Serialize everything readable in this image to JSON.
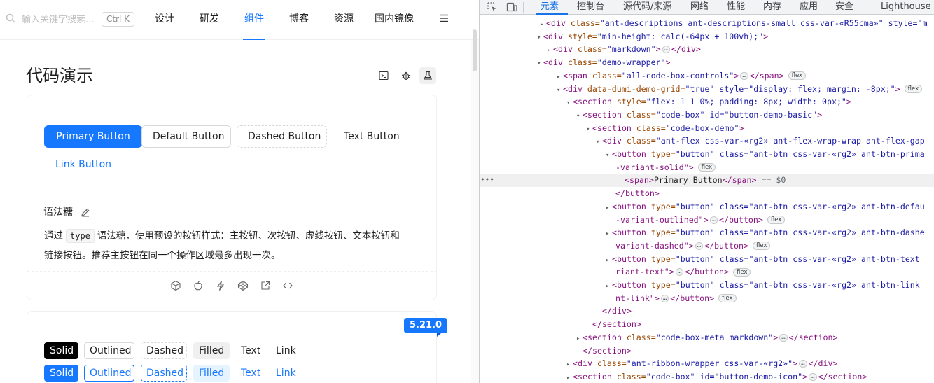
{
  "site": {
    "search": {
      "placeholder": "输入关键字搜索...",
      "shortcut": "Ctrl K"
    },
    "nav": [
      "设计",
      "研发",
      "组件",
      "博客",
      "资源",
      "国内镜像"
    ],
    "active_nav": "组件",
    "menu_icon": "hamburger-icon",
    "title": "代码演示",
    "tools": [
      "code-terminal-icon",
      "bug-icon",
      "beaker-icon"
    ],
    "demo1": {
      "buttons": [
        "Primary Button",
        "Default Button",
        "Dashed Button",
        "Text Button",
        "Link Button"
      ],
      "meta_title": "语法糖",
      "desc_before": "通过",
      "desc_code": "type",
      "desc_after_line1": "语法糖，使用预设的按钮样式：主按钮、次按钮、虚线按钮、文本按钮和",
      "desc_line2": "链接按钮。推荐主按钮在同一个操作区域最多出现一次。",
      "actions": [
        "codesandbox-icon",
        "apple-icon",
        "lightning-icon",
        "codepen-icon",
        "external-link-icon",
        "code-icon"
      ]
    },
    "demo2": {
      "version": "5.21.0",
      "row1": [
        "Solid",
        "Outlined",
        "Dashed",
        "Filled",
        "Text",
        "Link"
      ],
      "row2": [
        "Solid",
        "Outlined",
        "Dashed",
        "Filled",
        "Text",
        "Link"
      ]
    },
    "colors": {
      "primary": "#1677ff",
      "border": "#d9d9d9",
      "divider": "#f0f0f0"
    }
  },
  "devtools": {
    "tabs": [
      "元素",
      "控制台",
      "源代码/来源",
      "网络",
      "性能",
      "内存",
      "应用",
      "安全",
      "Lighthouse"
    ],
    "active_tab": "元素",
    "selected_suffix": "== $0",
    "flex_badge": "flex",
    "lines": [
      [
        "▸",
        "<div ",
        "class=",
        "\"ant-descriptions ant-descriptions-small css-var-«R55cma»\"",
        " style=\"m"
      ],
      [
        "▾",
        "<div ",
        "style=",
        "\"min-height: calc(-64px + 100vh);\"",
        ">"
      ],
      [
        "▸",
        "<div ",
        "class=",
        "\"markdown\"",
        ">…</div>"
      ],
      [
        "▾",
        "<div ",
        "class=",
        "\"demo-wrapper\"",
        ">"
      ],
      [
        "▸",
        "<span ",
        "class=",
        "\"all-code-box-controls\"",
        ">…</span>"
      ],
      [
        "▾",
        "<div ",
        "data-dumi-demo-grid=",
        "\"true\" style=\"display: flex; margin: -8px;\"",
        ">"
      ],
      [
        "▾",
        "<section ",
        "style=",
        "\"flex: 1 1 0%; padding: 8px; width: 0px;\"",
        ">"
      ],
      [
        "▾",
        "<section ",
        "class=",
        "\"code-box\" id=\"button-demo-basic\"",
        ">"
      ],
      [
        "▾",
        "<section ",
        "class=",
        "\"code-box-demo\"",
        ">"
      ],
      [
        "▾",
        "<div ",
        "class=",
        "\"ant-flex css-var-«rg2» ant-flex-wrap-wrap ant-flex-gap",
        ""
      ],
      [
        "▾",
        "<button ",
        "type=",
        "\"button\" class=\"ant-btn css-var-«rg2» ant-btn-prima",
        ""
      ],
      [
        "",
        "-variant-solid\"",
        "",
        "",
        ">"
      ],
      [
        "",
        "<span>",
        "",
        "Primary Button",
        "</span>"
      ],
      [
        "",
        "</button>",
        "",
        "",
        ""
      ],
      [
        "▸",
        "<button ",
        "type=",
        "\"button\" class=\"ant-btn css-var-«rg2» ant-btn-defau",
        ""
      ],
      [
        "",
        "-variant-outlined\"",
        "",
        "",
        ">…</button>"
      ],
      [
        "▸",
        "<button ",
        "type=",
        "\"button\" class=\"ant-btn css-var-«rg2» ant-btn-dashe",
        ""
      ],
      [
        "",
        "variant-dashed\"",
        "",
        "",
        ">…</button>"
      ],
      [
        "▸",
        "<button ",
        "type=",
        "\"button\" class=\"ant-btn css-var-«rg2» ant-btn-text",
        ""
      ],
      [
        "",
        "riant-text\"",
        "",
        "",
        ">…</button>"
      ],
      [
        "▸",
        "<button ",
        "type=",
        "\"button\" class=\"ant-btn css-var-«rg2» ant-btn-link",
        ""
      ],
      [
        "",
        "nt-link\"",
        "",
        "",
        ">…</button>"
      ],
      [
        "",
        "</div>",
        "",
        "",
        ""
      ],
      [
        "",
        "</section>",
        "",
        "",
        ""
      ],
      [
        "▸",
        "<section ",
        "class=",
        "\"code-box-meta markdown\"",
        ">…</section>"
      ],
      [
        "",
        "</section>",
        "",
        "",
        ""
      ],
      [
        "▸",
        "<div ",
        "class=",
        "\"ant-ribbon-wrapper css-var-«rg2»\"",
        ">…</div>"
      ],
      [
        "▸",
        "<section ",
        "class=",
        "\"code-box\" id=\"button-demo-icon\"",
        ">…</section>"
      ]
    ]
  }
}
